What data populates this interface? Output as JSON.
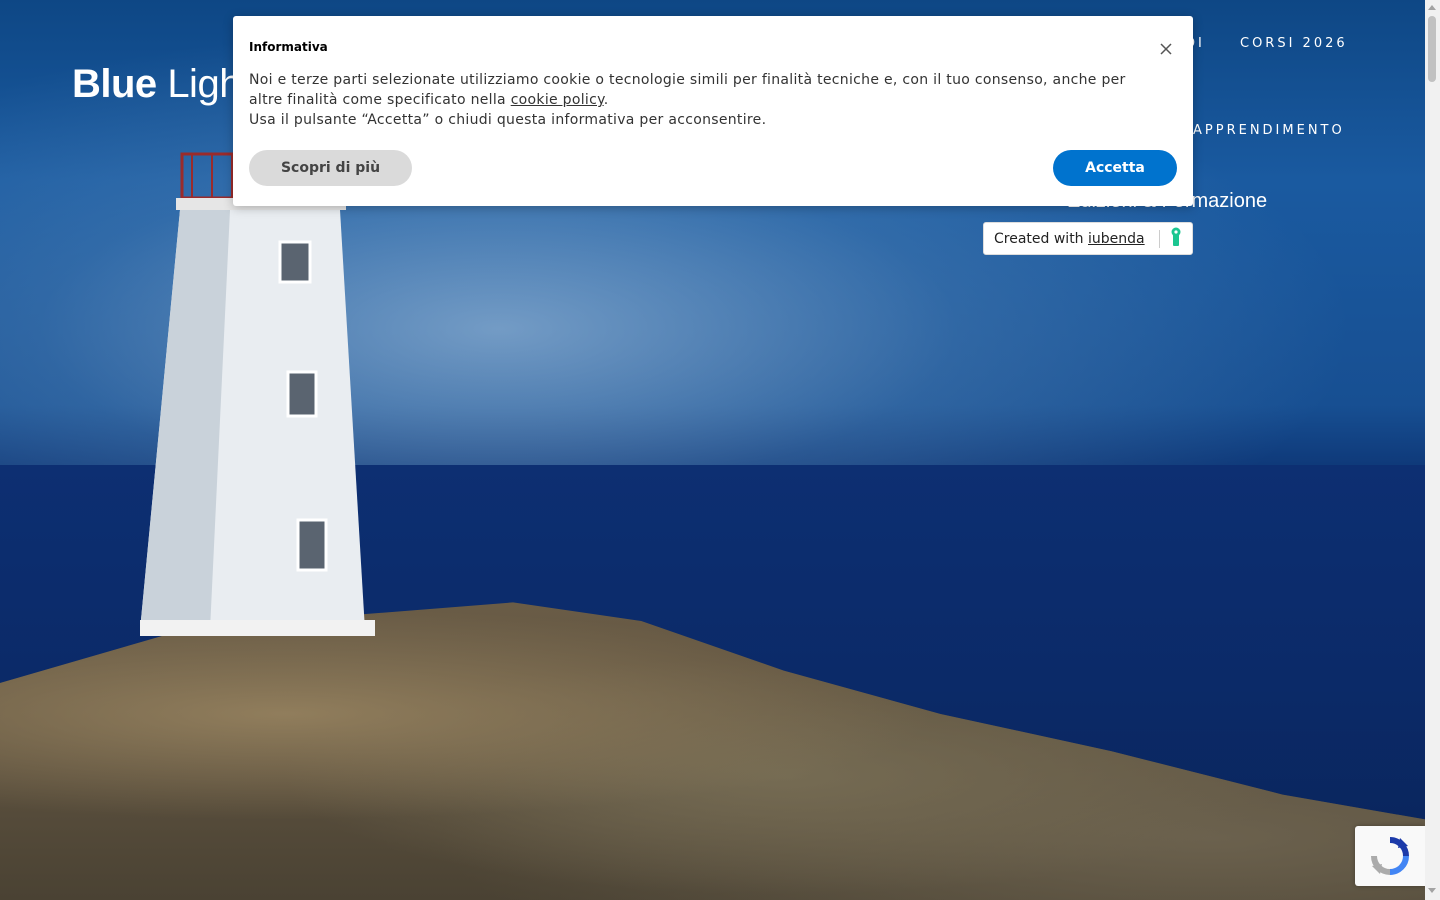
{
  "brand": {
    "name_bold": "Blue",
    "name_light": "Light"
  },
  "nav": {
    "item_partial": "DI",
    "item_courses": "CORSI 2026",
    "item_learning": "APPRENDIMENTO"
  },
  "tagline": "Edizioni & Formazione",
  "cookie_banner": {
    "title": "Informativa",
    "text_part1": "Noi e terze parti selezionate utilizziamo cookie o tecnologie simili per finalità tecniche e, con il tuo consenso, anche per altre finalità come specificato nella ",
    "policy_link": "cookie policy",
    "text_part2": ".",
    "text_line3": "Usa il pulsante “Accetta” o chiudi questa informativa per acconsentire.",
    "learn_more_label": "Scopri di più",
    "accept_label": "Accetta",
    "close_icon": "close-icon"
  },
  "iubenda_badge": {
    "prefix": "Created with ",
    "link": "iubenda",
    "logo_icon": "iubenda-logo-icon"
  },
  "recaptcha": {
    "icon": "recaptcha-icon"
  },
  "colors": {
    "accept_button": "#0073ce",
    "learn_more_button": "#dadada",
    "iubenda_green": "#1cc691"
  }
}
